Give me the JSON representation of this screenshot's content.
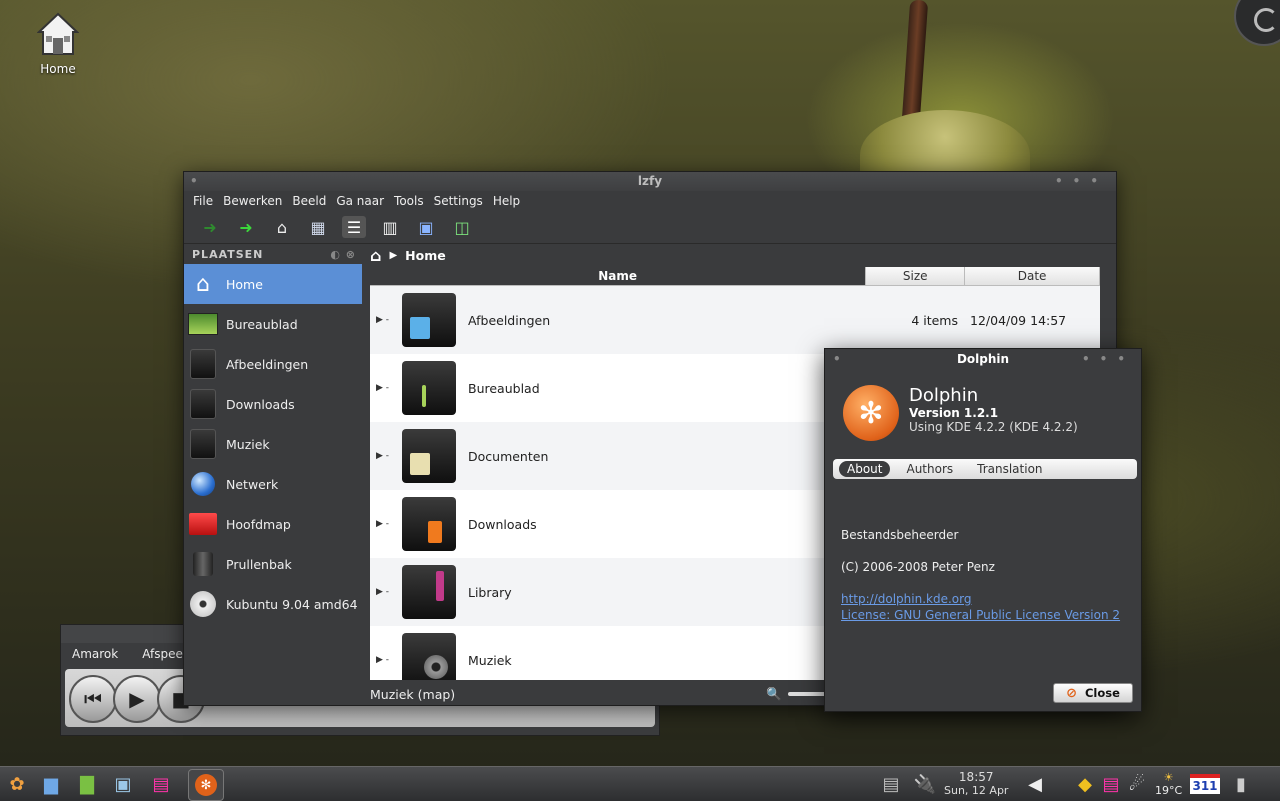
{
  "desktop": {
    "home_label": "Home"
  },
  "amarok": {
    "menu": [
      "Amarok",
      "Afspeellijs"
    ],
    "controls_text": "[|||]",
    "plus": "+"
  },
  "dolphin": {
    "title": "lzfy",
    "menu": [
      "File",
      "Bewerken",
      "Beeld",
      "Ga naar",
      "Tools",
      "Settings",
      "Help"
    ],
    "places_title": "PLAATSEN",
    "places": [
      {
        "label": "Home",
        "icon": "home-icon",
        "active": true
      },
      {
        "label": "Bureaublad",
        "icon": "desktop-icon"
      },
      {
        "label": "Afbeeldingen",
        "icon": "folder-icon"
      },
      {
        "label": "Downloads",
        "icon": "folder-icon"
      },
      {
        "label": "Muziek",
        "icon": "folder-icon"
      },
      {
        "label": "Netwerk",
        "icon": "network-icon"
      },
      {
        "label": "Hoofdmap",
        "icon": "red-folder-icon"
      },
      {
        "label": "Prullenbak",
        "icon": "trash-icon"
      },
      {
        "label": "Kubuntu 9.04 amd64",
        "icon": "cdrom-icon"
      }
    ],
    "breadcrumb": "Home",
    "columns": {
      "name": "Name",
      "size": "Size",
      "date": "Date"
    },
    "files": [
      {
        "name": "Afbeeldingen",
        "size": "4 items",
        "date": "12/04/09 14:57",
        "color": "#5bb0e8"
      },
      {
        "name": "Bureaublad",
        "size": "",
        "date": "",
        "color": "#a7d35a"
      },
      {
        "name": "Documenten",
        "size": "",
        "date": "",
        "color": "#e8dfb0"
      },
      {
        "name": "Downloads",
        "size": "",
        "date": "",
        "color": "#f07a1e"
      },
      {
        "name": "Library",
        "size": "",
        "date": "",
        "color": "#c23a8a"
      },
      {
        "name": "Muziek",
        "size": "",
        "date": "",
        "color": "#9a9a9a"
      }
    ],
    "status": "Muziek (map)"
  },
  "about": {
    "title": "Dolphin",
    "app_name": "Dolphin",
    "version": "Version 1.2.1",
    "using": "Using KDE 4.2.2 (KDE 4.2.2)",
    "tabs": [
      "About",
      "Authors",
      "Translation"
    ],
    "description": "Bestandsbeheerder",
    "copyright": "(C) 2006-2008 Peter Penz",
    "url": "http://dolphin.kde.org",
    "license": "License: GNU General Public License Version 2",
    "close_label": "Close"
  },
  "taskbar": {
    "time": "18:57",
    "date": "Sun, 12 Apr",
    "temperature": "19°C",
    "calendar_day": "311"
  }
}
